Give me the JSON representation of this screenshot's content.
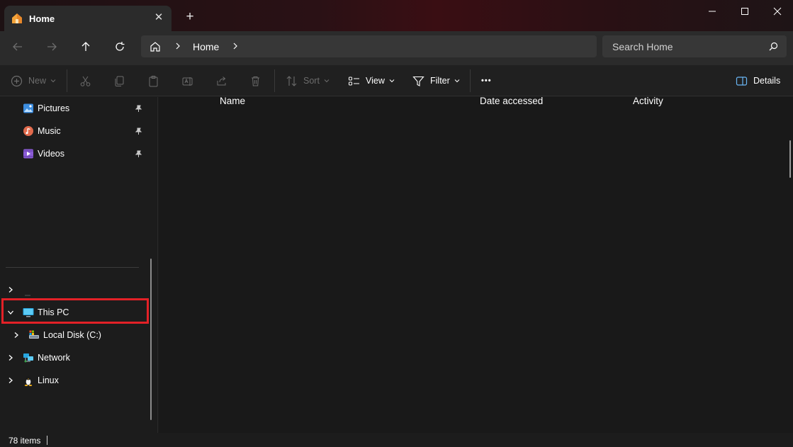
{
  "window": {
    "tab_title": "Home",
    "new_tab_symbol": "+",
    "close_tab_symbol": "✕"
  },
  "address": {
    "crumb": "Home",
    "search_placeholder": "Search Home"
  },
  "commands": {
    "new": "New",
    "sort": "Sort",
    "view": "View",
    "filter": "Filter",
    "more": "•••",
    "details": "Details"
  },
  "sidebar": {
    "quick_access": [
      {
        "label": "Pictures",
        "icon": "pictures-icon"
      },
      {
        "label": "Music",
        "icon": "music-icon"
      },
      {
        "label": "Videos",
        "icon": "videos-icon"
      }
    ],
    "tree": {
      "this_pc": "This PC",
      "local_disk": "Local Disk (C:)",
      "network": "Network",
      "linux": "Linux"
    }
  },
  "columns": {
    "name": "Name",
    "date_accessed": "Date accessed",
    "activity": "Activity"
  },
  "status": {
    "items": "78 items"
  },
  "colors": {
    "highlight_border": "#e32127",
    "titlebar_accent": "#3a0e13"
  }
}
